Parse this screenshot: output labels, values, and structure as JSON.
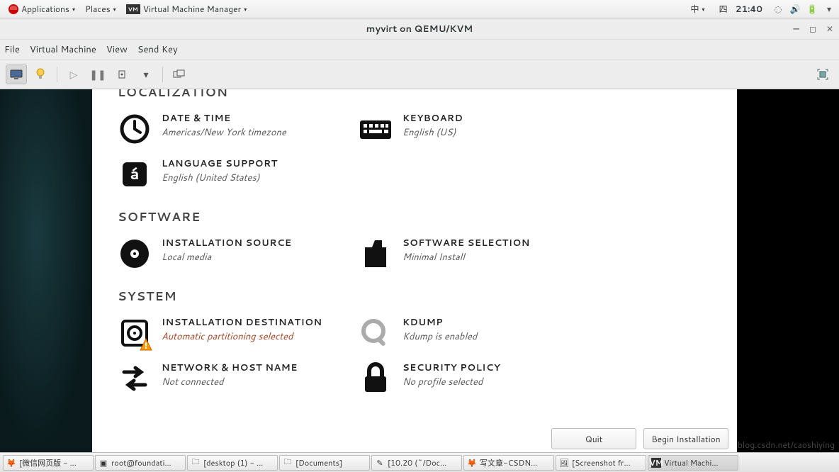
{
  "panel": {
    "applications": "Applications",
    "places": "Places",
    "vmm": "Virtual Machine Manager",
    "ime": "中",
    "day": "四",
    "time": "21:40"
  },
  "window": {
    "title": "myvirt on QEMU/KVM",
    "menu": {
      "file": "File",
      "vm": "Virtual Machine",
      "view": "View",
      "sendkey": "Send Key"
    }
  },
  "installer": {
    "sections": {
      "localization": "LOCALIZATION",
      "software": "SOFTWARE",
      "system": "SYSTEM"
    },
    "items": {
      "datetime": {
        "title": "DATE & TIME",
        "sub": "Americas/New York timezone"
      },
      "keyboard": {
        "title": "KEYBOARD",
        "sub": "English (US)"
      },
      "language": {
        "title": "LANGUAGE SUPPORT",
        "sub": "English (United States)"
      },
      "source": {
        "title": "INSTALLATION SOURCE",
        "sub": "Local media"
      },
      "selection": {
        "title": "SOFTWARE SELECTION",
        "sub": "Minimal Install"
      },
      "destination": {
        "title": "INSTALLATION DESTINATION",
        "sub": "Automatic partitioning selected"
      },
      "kdump": {
        "title": "KDUMP",
        "sub": "Kdump is enabled"
      },
      "network": {
        "title": "NETWORK & HOST NAME",
        "sub": "Not connected"
      },
      "security": {
        "title": "SECURITY POLICY",
        "sub": "No profile selected"
      }
    },
    "buttons": {
      "quit": "Quit",
      "begin": "Begin Installation"
    }
  },
  "taskbar": {
    "t1": "[微信网页版 - ...",
    "t2": "root@foundati...",
    "t3": "[desktop (1) - ...",
    "t4": "[Documents]",
    "t5": "[10.20 (~/Doc...",
    "t6": "写文章-CSDN...",
    "t7": "[Screenshot fr...",
    "t8": "Virtual Machi..."
  },
  "watermark": "blog.csdn.net/caoshiying"
}
